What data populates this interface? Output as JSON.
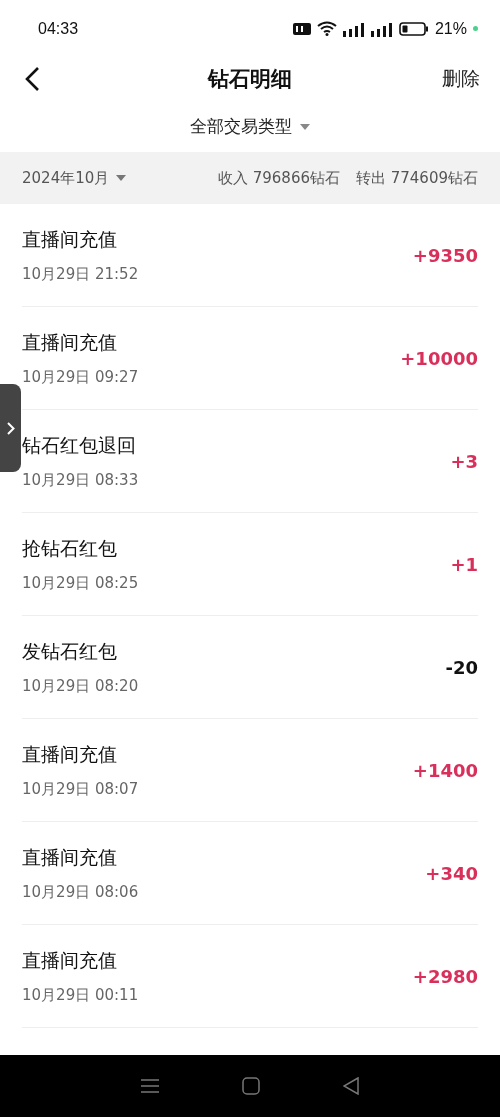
{
  "status_bar": {
    "time": "04:33",
    "battery": "21%"
  },
  "nav": {
    "title": "钻石明细",
    "action": "删除"
  },
  "filter": {
    "label": "全部交易类型"
  },
  "summary": {
    "month": "2024年10月",
    "income": "收入 796866钻石",
    "outgoing": "转出 774609钻石"
  },
  "transactions": [
    {
      "title": "直播间充值",
      "time": "10月29日 21:52",
      "amount": "+9350",
      "kind": "income"
    },
    {
      "title": "直播间充值",
      "time": "10月29日 09:27",
      "amount": "+10000",
      "kind": "income"
    },
    {
      "title": "钻石红包退回",
      "time": "10月29日 08:33",
      "amount": "+3",
      "kind": "income"
    },
    {
      "title": "抢钻石红包",
      "time": "10月29日 08:25",
      "amount": "+1",
      "kind": "income"
    },
    {
      "title": "发钻石红包",
      "time": "10月29日 08:20",
      "amount": "-20",
      "kind": "expense"
    },
    {
      "title": "直播间充值",
      "time": "10月29日 08:07",
      "amount": "+1400",
      "kind": "income"
    },
    {
      "title": "直播间充值",
      "time": "10月29日 08:06",
      "amount": "+340",
      "kind": "income"
    },
    {
      "title": "直播间充值",
      "time": "10月29日 00:11",
      "amount": "+2980",
      "kind": "income"
    }
  ]
}
